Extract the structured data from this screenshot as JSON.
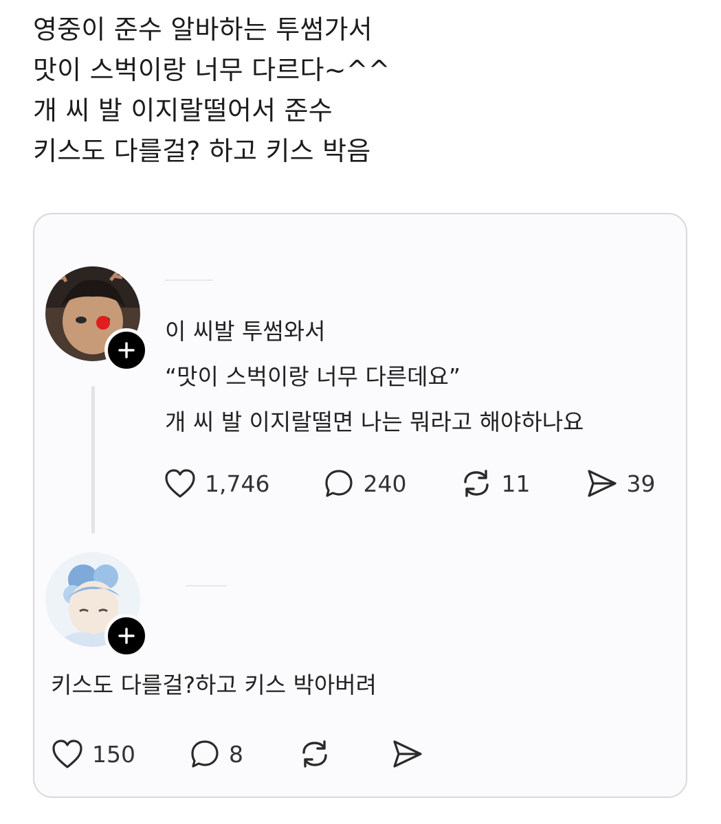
{
  "caption": {
    "lines": [
      "영중이 준수 알바하는 투썸가서",
      "맛이 스벅이랑 너무 다르다~^^",
      "개 씨 발 이지랄떨어서 준수",
      "키스도 다를걸? 하고 키스 박음"
    ]
  },
  "post1": {
    "lines": [
      "이 씨발 투썸와서",
      "“맛이 스벅이랑 너무 다른데요”",
      "개 씨 발 이지랄떨면 나는 뭐라고 해야하나요"
    ],
    "likes": "1,746",
    "replies": "240",
    "reposts": "11",
    "shares": "39",
    "icons": [
      "heart-icon",
      "comment-icon",
      "repost-icon",
      "share-icon"
    ]
  },
  "post2": {
    "text": "키스도 다를걸?하고 키스 박아버려",
    "likes": "150",
    "replies": "8",
    "icons": [
      "heart-icon",
      "comment-icon",
      "repost-icon",
      "share-icon"
    ]
  },
  "colors": {
    "card_bg": "#fbfafc",
    "card_border": "#d7d9dc",
    "badge": "#000000",
    "thread_line": "#e3e3e6"
  }
}
